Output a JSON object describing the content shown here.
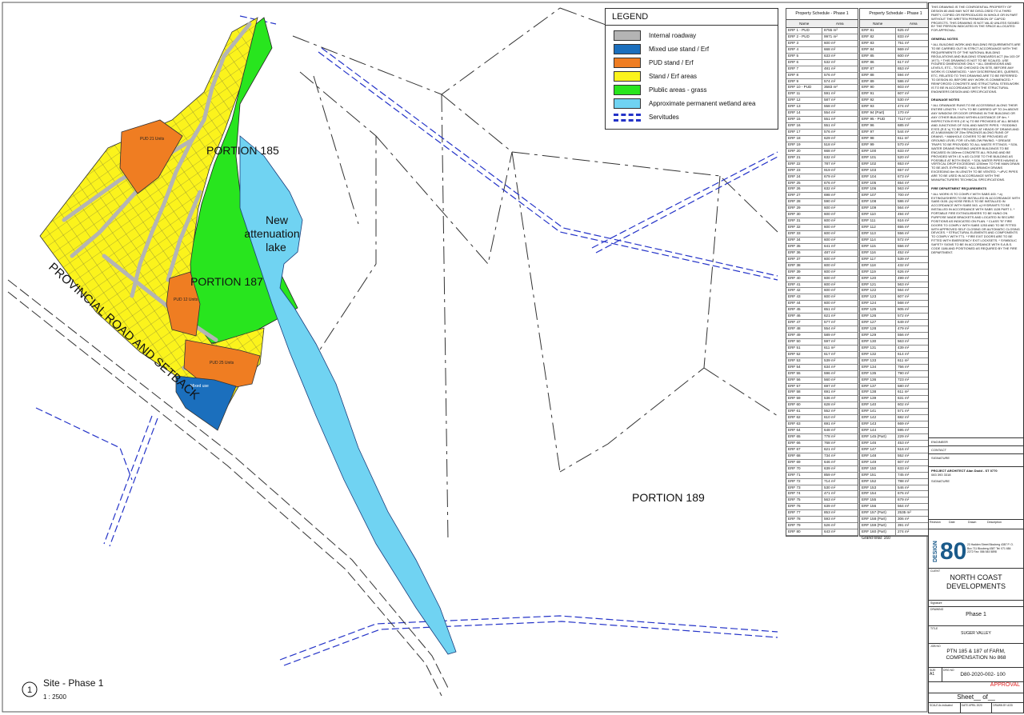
{
  "legend": {
    "title": "LEGEND",
    "items": [
      {
        "label": "Internal roadway",
        "color": "#b4b4b4"
      },
      {
        "label": "Mixed use stand / Erf",
        "color": "#1b6fbd"
      },
      {
        "label": "PUD stand / Erf",
        "color": "#ef7d22"
      },
      {
        "label": "Stand / Erf areas",
        "color": "#fbf31c"
      },
      {
        "label": "Plublic areas - grass",
        "color": "#28e51e"
      },
      {
        "label": "Approximate permanent wetland area",
        "color": "#70d3f2"
      },
      {
        "label": "Servitudes",
        "color": "#2433c8"
      }
    ]
  },
  "map": {
    "portion_185": "PORTION 185",
    "portion_187": "PORTION 187",
    "portion_189": "PORTION 189",
    "lake": [
      "New",
      "attenuation",
      "lake"
    ],
    "road": "PROVINCIAL ROAD AND SETBACK",
    "pud_21": "PUD 21 Units",
    "pud_12": "PUD 12 Units",
    "pud_25": "PUD 25 Units",
    "mixed_use": "Mixed use"
  },
  "view": {
    "number": "1",
    "title": "Site - Phase 1",
    "scale": "1 : 2500"
  },
  "schedule_1": {
    "title": "Property Schedule - Phase 1",
    "col_name": "Name",
    "col_area": "Area",
    "rows": [
      [
        "ERF 1 - PUD",
        "8755 m²"
      ],
      [
        "ERF 2 - PUD",
        "9971 m²"
      ],
      [
        "ERF 3",
        "600 m²"
      ],
      [
        "ERF 4",
        "668 m²"
      ],
      [
        "ERF 5",
        "633 m²"
      ],
      [
        "ERF 6",
        "532 m²"
      ],
      [
        "ERF 7",
        "481 m²"
      ],
      [
        "ERF 8",
        "576 m²"
      ],
      [
        "ERF 9",
        "574 m²"
      ],
      [
        "ERF 10 - PUD",
        "3583 m²"
      ],
      [
        "ERF 11",
        "591 m²"
      ],
      [
        "ERF 12",
        "587 m²"
      ],
      [
        "ERF 13",
        "558 m²"
      ],
      [
        "ERF 14",
        "554 m²"
      ],
      [
        "ERF 15",
        "551 m²"
      ],
      [
        "ERF 16",
        "551 m²"
      ],
      [
        "ERF 17",
        "576 m²"
      ],
      [
        "ERF 18",
        "629 m²"
      ],
      [
        "ERF 19",
        "518 m²"
      ],
      [
        "ERF 20",
        "668 m²"
      ],
      [
        "ERF 21",
        "632 m²"
      ],
      [
        "ERF 22",
        "787 m²"
      ],
      [
        "ERF 23",
        "919 m²"
      ],
      [
        "ERF 24",
        "679 m²"
      ],
      [
        "ERF 25",
        "676 m²"
      ],
      [
        "ERF 26",
        "632 m²"
      ],
      [
        "ERF 27",
        "698 m²"
      ],
      [
        "ERF 28",
        "590 m²"
      ],
      [
        "ERF 29",
        "600 m²"
      ],
      [
        "ERF 30",
        "600 m²"
      ],
      [
        "ERF 31",
        "600 m²"
      ],
      [
        "ERF 32",
        "600 m²"
      ],
      [
        "ERF 33",
        "600 m²"
      ],
      [
        "ERF 34",
        "600 m²"
      ],
      [
        "ERF 35",
        "641 m²"
      ],
      [
        "ERF 36",
        "487 m²"
      ],
      [
        "ERF 37",
        "600 m²"
      ],
      [
        "ERF 38",
        "600 m²"
      ],
      [
        "ERF 39",
        "600 m²"
      ],
      [
        "ERF 40",
        "600 m²"
      ],
      [
        "ERF 41",
        "600 m²"
      ],
      [
        "ERF 42",
        "600 m²"
      ],
      [
        "ERF 43",
        "600 m²"
      ],
      [
        "ERF 44",
        "600 m²"
      ],
      [
        "ERF 45",
        "651 m²"
      ],
      [
        "ERF 46",
        "621 m²"
      ],
      [
        "ERF 47",
        "577 m²"
      ],
      [
        "ERF 48",
        "554 m²"
      ],
      [
        "ERF 49",
        "589 m²"
      ],
      [
        "ERF 50",
        "597 m²"
      ],
      [
        "ERF 51",
        "611 m²"
      ],
      [
        "ERF 52",
        "617 m²"
      ],
      [
        "ERF 53",
        "539 m²"
      ],
      [
        "ERF 54",
        "634 m²"
      ],
      [
        "ERF 55",
        "596 m²"
      ],
      [
        "ERF 56",
        "560 m²"
      ],
      [
        "ERF 57",
        "697 m²"
      ],
      [
        "ERF 58",
        "691 m²"
      ],
      [
        "ERF 59",
        "536 m²"
      ],
      [
        "ERF 60",
        "628 m²"
      ],
      [
        "ERF 61",
        "552 m²"
      ],
      [
        "ERF 62",
        "610 m²"
      ],
      [
        "ERF 63",
        "691 m²"
      ],
      [
        "ERF 64",
        "648 m²"
      ],
      [
        "ERF 65",
        "778 m²"
      ],
      [
        "ERF 66",
        "768 m²"
      ],
      [
        "ERF 67",
        "621 m²"
      ],
      [
        "ERF 68",
        "734 m²"
      ],
      [
        "ERF 69",
        "646 m²"
      ],
      [
        "ERF 70",
        "639 m²"
      ],
      [
        "ERF 71",
        "859 m²"
      ],
      [
        "ERF 72",
        "714 m²"
      ],
      [
        "ERF 73",
        "530 m²"
      ],
      [
        "ERF 74",
        "471 m²"
      ],
      [
        "ERF 75",
        "563 m²"
      ],
      [
        "ERF 76",
        "639 m²"
      ],
      [
        "ERF 77",
        "853 m²"
      ],
      [
        "ERF 78",
        "593 m²"
      ],
      [
        "ERF 79",
        "526 m²"
      ],
      [
        "ERF 80",
        "643 m²"
      ]
    ]
  },
  "schedule_2": {
    "title": "Property Schedule - Phase 1",
    "col_name": "Name",
    "col_area": "Area",
    "rows": [
      [
        "ERF 81",
        "625 m²"
      ],
      [
        "ERF 82",
        "833 m²"
      ],
      [
        "ERF 83",
        "751 m²"
      ],
      [
        "ERF 84",
        "669 m²"
      ],
      [
        "ERF 85",
        "600 m²"
      ],
      [
        "ERF 86",
        "617 m²"
      ],
      [
        "ERF 87",
        "653 m²"
      ],
      [
        "ERF 88",
        "594 m²"
      ],
      [
        "ERF 89",
        "586 m²"
      ],
      [
        "ERF 90",
        "603 m²"
      ],
      [
        "ERF 91",
        "607 m²"
      ],
      [
        "ERF 92",
        "530 m²"
      ],
      [
        "ERF 93",
        "474 m²"
      ],
      [
        "ERF 94 (Part)",
        "170 m²"
      ],
      [
        "ERF 95 - PUD",
        "7117 m²"
      ],
      [
        "ERF 96",
        "685 m²"
      ],
      [
        "ERF 97",
        "544 m²"
      ],
      [
        "ERF 98",
        "611 m²"
      ],
      [
        "ERF 99",
        "570 m²"
      ],
      [
        "ERF 100",
        "633 m²"
      ],
      [
        "ERF 101",
        "520 m²"
      ],
      [
        "ERF 102",
        "653 m²"
      ],
      [
        "ERF 103",
        "657 m²"
      ],
      [
        "ERF 104",
        "673 m²"
      ],
      [
        "ERF 105",
        "654 m²"
      ],
      [
        "ERF 106",
        "563 m²"
      ],
      [
        "ERF 107",
        "700 m²"
      ],
      [
        "ERF 108",
        "586 m²"
      ],
      [
        "ERF 109",
        "564 m²"
      ],
      [
        "ERF 110",
        "494 m²"
      ],
      [
        "ERF 111",
        "616 m²"
      ],
      [
        "ERF 112",
        "655 m²"
      ],
      [
        "ERF 113",
        "556 m²"
      ],
      [
        "ERF 114",
        "572 m²"
      ],
      [
        "ERF 115",
        "556 m²"
      ],
      [
        "ERF 116",
        "452 m²"
      ],
      [
        "ERF 117",
        "539 m²"
      ],
      [
        "ERF 118",
        "432 m²"
      ],
      [
        "ERF 119",
        "626 m²"
      ],
      [
        "ERF 120",
        "499 m²"
      ],
      [
        "ERF 121",
        "563 m²"
      ],
      [
        "ERF 122",
        "564 m²"
      ],
      [
        "ERF 123",
        "607 m²"
      ],
      [
        "ERF 124",
        "568 m²"
      ],
      [
        "ERF 125",
        "605 m²"
      ],
      [
        "ERF 126",
        "572 m²"
      ],
      [
        "ERF 127",
        "649 m²"
      ],
      [
        "ERF 128",
        "479 m²"
      ],
      [
        "ERF 129",
        "556 m²"
      ],
      [
        "ERF 130",
        "563 m²"
      ],
      [
        "ERF 131",
        "439 m²"
      ],
      [
        "ERF 132",
        "614 m²"
      ],
      [
        "ERF 133",
        "611 m²"
      ],
      [
        "ERF 134",
        "756 m²"
      ],
      [
        "ERF 135",
        "790 m²"
      ],
      [
        "ERF 136",
        "723 m²"
      ],
      [
        "ERF 137",
        "580 m²"
      ],
      [
        "ERF 138",
        "611 m²"
      ],
      [
        "ERF 139",
        "631 m²"
      ],
      [
        "ERF 140",
        "602 m²"
      ],
      [
        "ERF 141",
        "571 m²"
      ],
      [
        "ERF 142",
        "682 m²"
      ],
      [
        "ERF 143",
        "669 m²"
      ],
      [
        "ERF 144",
        "595 m²"
      ],
      [
        "ERF 145 (Part)",
        "229 m²"
      ],
      [
        "ERF 146",
        "453 m²"
      ],
      [
        "ERF 147",
        "516 m²"
      ],
      [
        "ERF 148",
        "552 m²"
      ],
      [
        "ERF 149",
        "607 m²"
      ],
      [
        "ERF 150",
        "633 m²"
      ],
      [
        "ERF 151",
        "745 m²"
      ],
      [
        "ERF 152",
        "788 m²"
      ],
      [
        "ERF 153",
        "546 m²"
      ],
      [
        "ERF 154",
        "676 m²"
      ],
      [
        "ERF 155",
        "679 m²"
      ],
      [
        "ERF 156",
        "564 m²"
      ],
      [
        "ERF 157 (Part)",
        "2535 m²"
      ],
      [
        "ERF 158 (Part)",
        "306 m²"
      ],
      [
        "ERF 159 (Part)",
        "391 m²"
      ],
      [
        "ERF 160 (Part)",
        "274 m²"
      ]
    ],
    "grand_total": "Grand total: 160"
  },
  "panel": {
    "disclaimer": "THIS DRAWING IS THE CONFIDENTIAL PROPERTY OF DESIGN 80 AND MAY NOT BE DISCLOSED TO A THIRD PARTY, COPIED OR REPRODUCED IN WHOLE OR IN PART WITHOUT THE WRITTEN PERMISSION OF CAPOD PROJECTS. THIS DRAWING IS NOT VALID UNLESS SIGNED BY THE PERSON INDICATED IN THE SPACE ALLOCATED FOR APPROVAL.",
    "general_title": "GENERAL NOTES",
    "general_text": "* ALL BUILDING WORK AND BUILDING REQUIREMENTS ARE TO BE CARRIED OUT IN STRICT ACCORDANCE WITH THE REQUIREMENTS OF THE NATIONAL BUILDING REGULATIONS AND BUILDING STANDARDS ACT (No 103 OF 1977). * THIS DRAWING IS NOT TO BE SCALED, USE FIGURED DIMENSIONS ONLY. * ALL DIMENSIONS AND LEVELS, ETC., TO BE CHECKED ON SITE, BEFORE ANY WORK IS COMMENCED. * ANY DISCREPANCIES, QUERIES, ETC, RELATED TO THIS DRAWING ARE TO BE REFERRED TO DESIGN 80, BEFORE ANY WORK IS COMMENCED. * REINFORCED CONCRETE AND STRUCTURAL STEELWORK IS TO BE IN ACCORDANCE WITH THE STRUCTURAL ENGINEERS DESIGN AND SPECIFICATIONS.",
    "drainage_title": "DRAINAGE NOTES",
    "drainage_text": "* ALL DRAINAGE RUNS TO BE ACCESSIBLE ALONG THEIR ENTIRE LENGTH. * V.P.s TO BE CARRIED UP TO 2m ABOVE ANY WINDOW OR DOOR OPENING IN THE BUILDING OR ANY OTHER BUILDING WITHIN A DISTANCE OF 6m. * INSPECTION EYES (I.E.'s) TO BE PROVIDED AT ALL BENDS AND JUNCTIONS OF SOIL AND WASTE PIPES. * RODDING EYES (R.E.'s) TO BE PROVIDED AT HEADS OF DRAINS AND AT A MAXIMUM OF 25m SPACINGS ALONG RUNS OF DRAINS. * MANHOLE COVERS TO BE PROVIDED AT GROUND LEVEL FOR I.E's BELOW PAVING. * GREASE TRAPS TO BE PROVIDED TO ALL WASTE FITTINGS. * SOIL WATER DRAINS PASSING UNDER BUILDINGS TO BE ENCASED IN 150mm CONCRETE ALL ROUND AND BE PROVIDED WITH I.E.'s AS CLOSE TO THE BUILDING AS POSSIBLE AT BOTH ENDS. * SOIL WATER PIPES HAVING A VERTICAL DROP EXCEEDING 1250mm TO THE MAIN DRAIN TO BE ANTI-SYPHONED. * ALL BRANCH DRAINS EXCEEDING 6m IN LENGTH TO BE VENTED. * uPVC PIPES ARE TO BE USED IN ACCORDANCE WITH THE MANUFACTURERS TECHNICAL SPECIFICATIONS.",
    "fire_title": "FIRE DEPARTMENT REQUIREMENTS",
    "fire_text": "* ALL WORK IS TO COMPLY WITH SABS 400. * a) EXTINGUISHERS TO BE INSTALLED IN ACCORDANCE WITH SABS 0105. (b) HOSE REELS TO BE INSTALLED IN ACCORDANCE WITH SABS 543. c) HYDRANTS TO BE INSTALLED IN ACCORDANCE WITH SABS 1128 PART 1. * PORTABLE FIRE EXTINGUISHERS TO BE HUNG ON PURPOSE MADE BRACKETS AND LOCATED IN SECURE POSITIONS AS INDICATED ON PLAN. * CLASS \"B\" FIRE DOORS TO COMPLY WITH SABS 1253 AND TO BE FITTED WITH APPROVED SELF CLOSING OR AUTOMATIC CLOSING DEVICES. * STRUCTURAL ELEMENTS AND COMPONENTS TO COMPLY WITH TT1. * FIRE EXIT DOORS ARE TO BE FITTED WITH EMERGENCY EXIT LOCKSETS. * SYMBOLIC SAFETY SIGNS TO BE IN ACCORDANCE WITH S.A.B.S. CODE 1186 AND POSITIONED AS REQUIRED BY THE FIRE DEPARTMENT.",
    "engineer": "ENGINEER",
    "contact": "CONTACT",
    "signature": "SIGNATURE",
    "architect": "PROJECT ARCHITECT Alan Dodd - ST 0770",
    "architect_contact": "083 393 3318",
    "rev_headers": [
      "Revision",
      "Date",
      "Drawn",
      "Description"
    ],
    "company_contact": "23 Hadden Street Blouberg 4387 P. O. Box 711 Blouberg 4387 Tel: 071 684 2272 Fax: 086 544 5898",
    "client_label": "CLIENT",
    "client": "NORTH COAST DEVELOPMENTS",
    "signature_label": "Signature",
    "drawing_label": "DRAWING",
    "drawing": "Phase 1",
    "title_label": "TITLE",
    "title": "SUGER VALLEY",
    "job_label": "JOB NO",
    "job": "PTN 185 & 187 of FARM, COMPENSATION No 868",
    "size_label": "SIZE",
    "size": "A1",
    "drg_label": "DRG NO",
    "drg_no": "D80-2020-002- 100",
    "status": "APPROVAL",
    "sheet": "Sheet__ of__",
    "scale_label": "SCALE",
    "scale": "As indicated",
    "date_label": "DATE",
    "date": "APRIL 2020",
    "drawn_label": "DRAWN BY",
    "drawn": "AOD"
  }
}
